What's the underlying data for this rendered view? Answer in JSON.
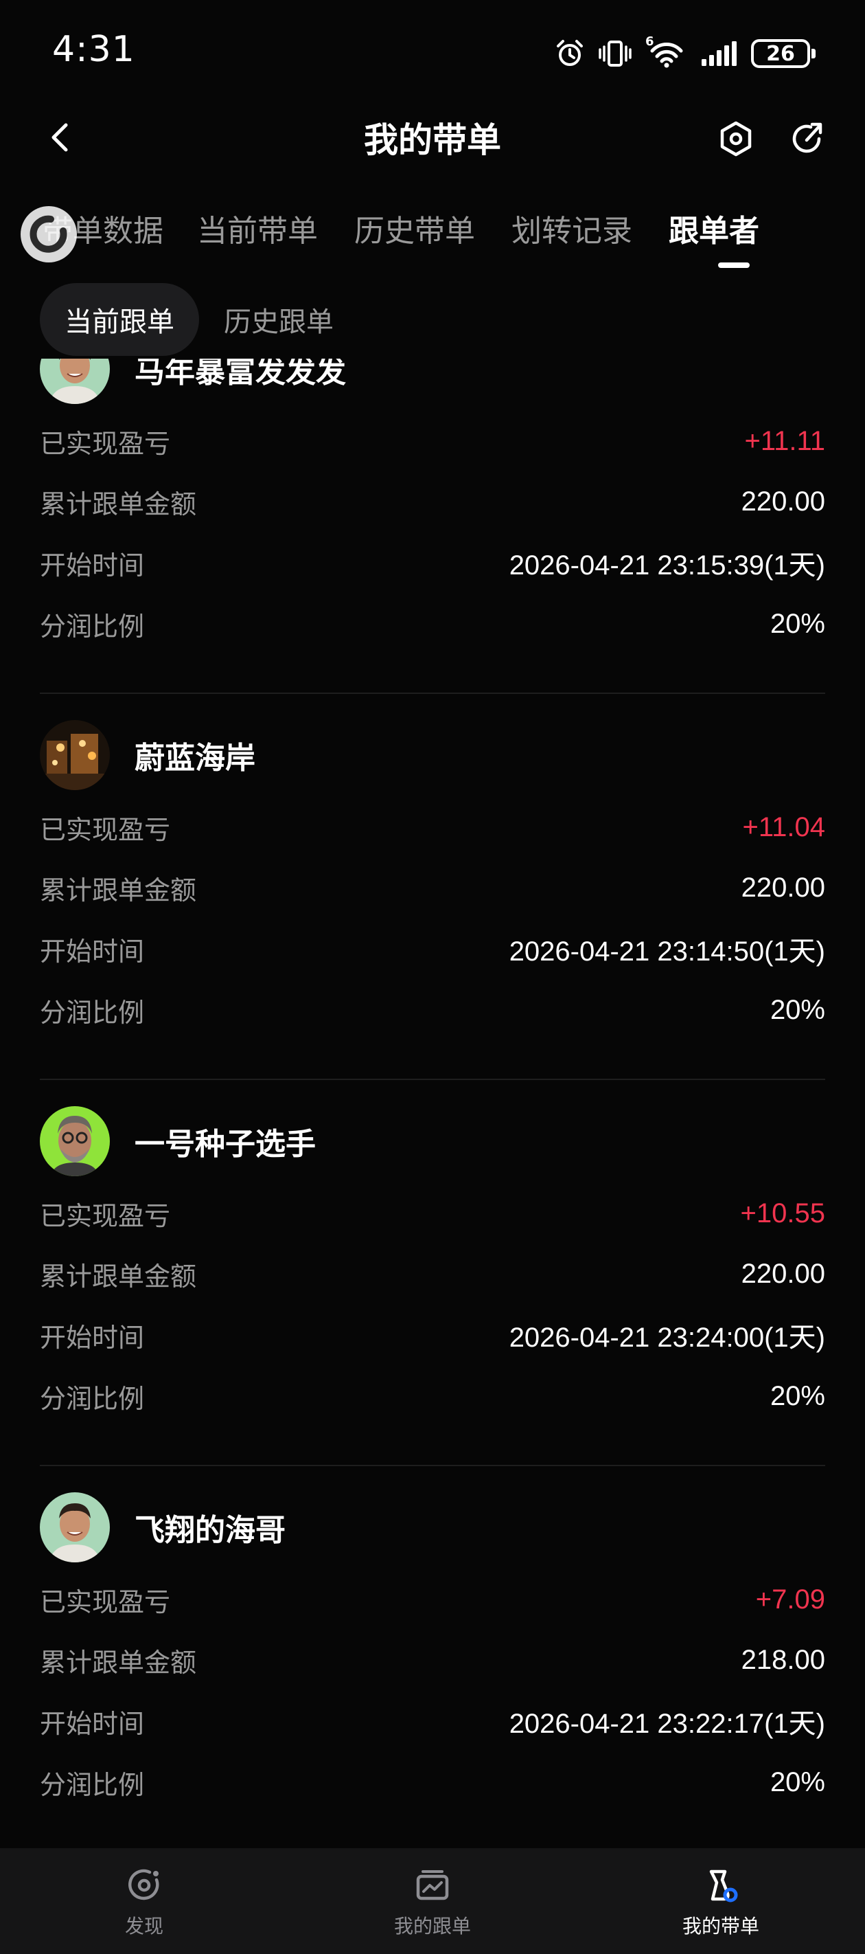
{
  "status_bar": {
    "time": "4:31",
    "battery": "26",
    "network": "6"
  },
  "header": {
    "title": "我的带单"
  },
  "tabs": [
    {
      "label": "带单数据"
    },
    {
      "label": "当前带单"
    },
    {
      "label": "历史带单"
    },
    {
      "label": "划转记录"
    },
    {
      "label": "跟单者"
    }
  ],
  "active_tab": "跟单者",
  "subtabs": [
    {
      "label": "当前跟单"
    },
    {
      "label": "历史跟单"
    }
  ],
  "active_subtab": "当前跟单",
  "colors": {
    "profit": "#f0344f",
    "background": "#060606",
    "accent": "#1e6fff"
  },
  "followers": [
    {
      "name": "马年暴富发发发",
      "avatar": "smiling-man-avatar",
      "realized_pnl_label": "已实现盈亏",
      "realized_pnl": "+11.11",
      "total_amount_label": "累计跟单金额",
      "total_amount": "220.00",
      "start_time_label": "开始时间",
      "start_time": "2026-04-21 23:15:39(1天)",
      "share_ratio_label": "分润比例",
      "share_ratio": "20%"
    },
    {
      "name": "蔚蓝海岸",
      "avatar": "night-street-avatar",
      "realized_pnl_label": "已实现盈亏",
      "realized_pnl": "+11.04",
      "total_amount_label": "累计跟单金额",
      "total_amount": "220.00",
      "start_time_label": "开始时间",
      "start_time": "2026-04-21 23:14:50(1天)",
      "share_ratio_label": "分润比例",
      "share_ratio": "20%"
    },
    {
      "name": "一号种子选手",
      "avatar": "glasses-man-avatar",
      "realized_pnl_label": "已实现盈亏",
      "realized_pnl": "+10.55",
      "total_amount_label": "累计跟单金额",
      "total_amount": "220.00",
      "start_time_label": "开始时间",
      "start_time": "2026-04-21 23:24:00(1天)",
      "share_ratio_label": "分润比例",
      "share_ratio": "20%"
    },
    {
      "name": "飞翔的海哥",
      "avatar": "smiling-man-avatar",
      "realized_pnl_label": "已实现盈亏",
      "realized_pnl": "+7.09",
      "total_amount_label": "累计跟单金额",
      "total_amount": "218.00",
      "start_time_label": "开始时间",
      "start_time": "2026-04-21 23:22:17(1天)",
      "share_ratio_label": "分润比例",
      "share_ratio": "20%"
    }
  ],
  "bottom_nav": [
    {
      "label": "发现",
      "icon": "discover-icon"
    },
    {
      "label": "我的跟单",
      "icon": "follow-chart-icon"
    },
    {
      "label": "我的带单",
      "icon": "lead-trade-icon"
    }
  ],
  "active_bottom_nav": "我的带单"
}
